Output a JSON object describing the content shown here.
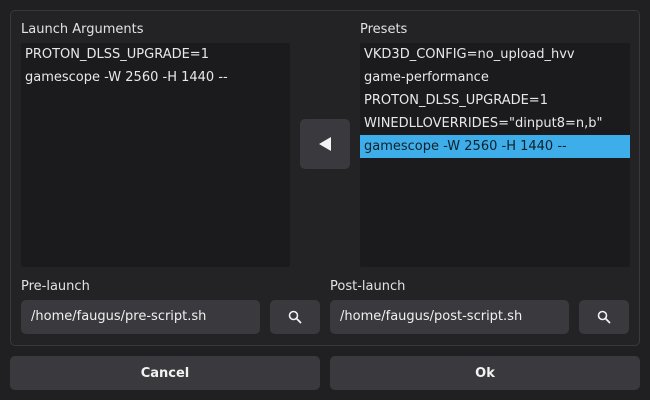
{
  "launch_arguments": {
    "label": "Launch Arguments",
    "items": [
      "PROTON_DLSS_UPGRADE=1",
      "gamescope -W 2560 -H 1440 --"
    ]
  },
  "presets": {
    "label": "Presets",
    "items": [
      "VKD3D_CONFIG=no_upload_hvv",
      "game-performance",
      "PROTON_DLSS_UPGRADE=1",
      "WINEDLLOVERRIDES=\"dinput8=n,b\"",
      "gamescope -W 2560 -H 1440 --"
    ],
    "selected_index": 4
  },
  "pre_launch": {
    "label": "Pre-launch",
    "value": "/home/faugus/pre-script.sh"
  },
  "post_launch": {
    "label": "Post-launch",
    "value": "/home/faugus/post-script.sh"
  },
  "buttons": {
    "cancel": "Cancel",
    "ok": "Ok"
  },
  "icons": {
    "add_preset": "triangle-left-icon",
    "browse": "search-icon"
  },
  "colors": {
    "selection": "#3daee9",
    "background": "#202023",
    "button": "#3a3a3e"
  }
}
